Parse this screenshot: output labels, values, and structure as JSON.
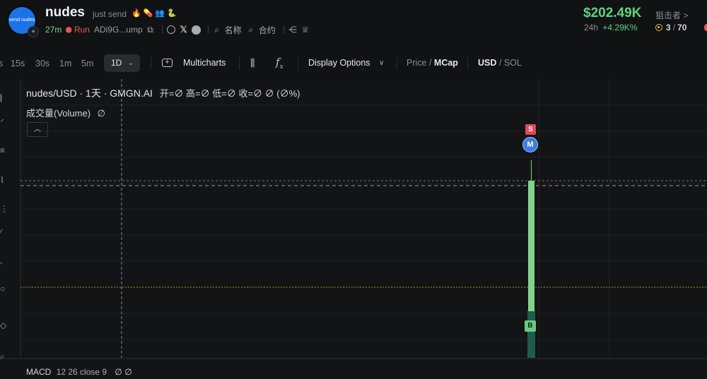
{
  "header": {
    "avatar_text": "send nudes",
    "avatar_badge_icon": "list-icon",
    "name": "nudes",
    "subtitle": "just send",
    "emojis": [
      "🔥",
      "💊",
      "👥",
      "🐍"
    ],
    "age": "27m",
    "run_label": "Run",
    "address": "ADi9G...ump",
    "name_label": "名称",
    "contract_label": "合约",
    "price": "$202.49K",
    "change_label": "24h",
    "change_value": "+4.29K%",
    "sniper_label": "狙击者 >",
    "holders_current": "3",
    "holders_total": "70"
  },
  "toolbar": {
    "timeframes": [
      "s",
      "15s",
      "30s",
      "1m",
      "5m"
    ],
    "active_timeframe": "1D",
    "multicharts_label": "Multicharts",
    "display_options_label": "Display Options",
    "price_label": "Price",
    "mcap_label": "MCap",
    "usd_label": "USD",
    "sol_label": "SOL"
  },
  "chart": {
    "title": "nudes/USD · 1天 · GMGN.AI",
    "ohlc": "开=∅  高=∅  低=∅  收=∅  ∅ (∅%)",
    "volume_label": "成交量(Volume)",
    "volume_value": "∅",
    "collapse_icon": "chevron-up-icon",
    "marker_s": "S",
    "marker_m": "M",
    "marker_b": "B",
    "macd_label": "MACD",
    "macd_params": "12 26 close 9",
    "macd_values": "∅  ∅",
    "colors": {
      "up": "#7fd48c",
      "volume": "#1f5b4b",
      "sell": "#e0485a",
      "buy": "#6cc985",
      "migrate": "#3e7ee0"
    }
  }
}
